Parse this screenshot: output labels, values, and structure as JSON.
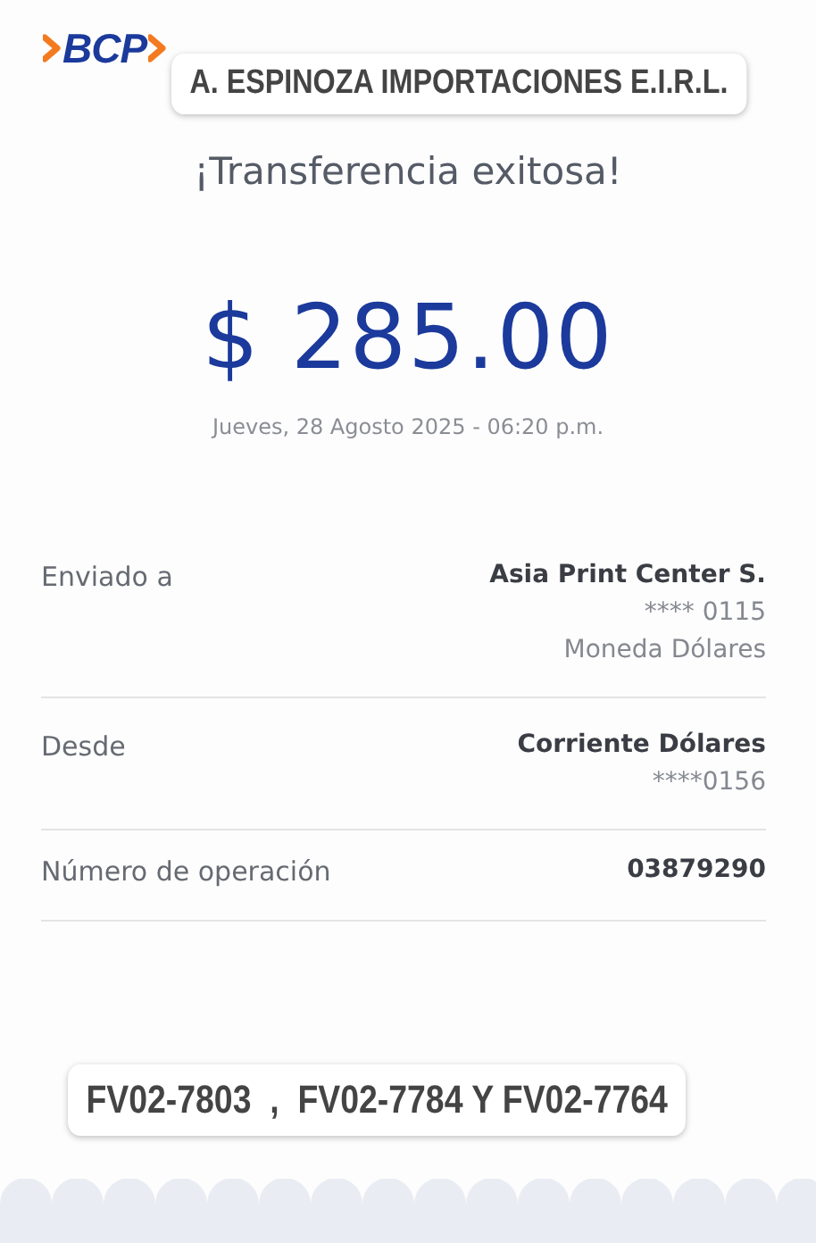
{
  "logo": {
    "text": "BCP"
  },
  "overlay_top": "A. ESPINOZA IMPORTACIONES E.I.R.L.",
  "title": "¡Transferencia exitosa!",
  "amount": "$ 285.00",
  "datetime": "Jueves, 28 Agosto 2025 - 06:20 p.m.",
  "details": [
    {
      "label": "Enviado a",
      "values": [
        "Asia Print Center S.",
        "**** 0115",
        "Moneda Dólares"
      ]
    },
    {
      "label": "Desde",
      "values": [
        "Corriente Dólares",
        "****0156"
      ]
    },
    {
      "label": "Número de operación",
      "values": [
        "03879290"
      ]
    }
  ],
  "overlay_bottom": "FV02-7803  ,  FV02-7784 Y FV02-7764"
}
